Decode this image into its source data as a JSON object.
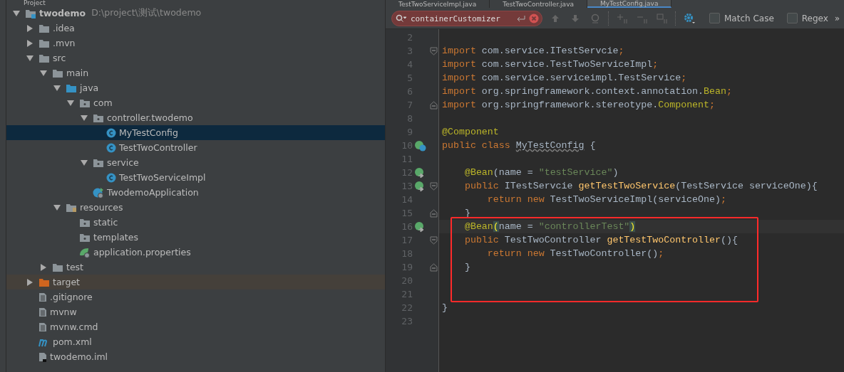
{
  "project_panel": {
    "title": "Project",
    "tree": [
      {
        "label": "twodemo",
        "path": "D:\\project\\测试\\twodemo",
        "kind": "module",
        "expanded": true,
        "selected": false,
        "children": [
          {
            "label": ".idea",
            "kind": "folder",
            "expanded": false,
            "selected": false
          },
          {
            "label": ".mvn",
            "kind": "folder",
            "expanded": false,
            "selected": false
          },
          {
            "label": "src",
            "kind": "folder",
            "expanded": true,
            "selected": false,
            "children": [
              {
                "label": "main",
                "kind": "folder",
                "expanded": true,
                "selected": false,
                "children": [
                  {
                    "label": "java",
                    "kind": "source",
                    "expanded": true,
                    "selected": false,
                    "children": [
                      {
                        "label": "com",
                        "kind": "package",
                        "expanded": true,
                        "selected": false,
                        "children": [
                          {
                            "label": "controller.twodemo",
                            "kind": "package",
                            "expanded": true,
                            "selected": false,
                            "children": [
                              {
                                "label": "MyTestConfig",
                                "kind": "class",
                                "selected": true
                              },
                              {
                                "label": "TestTwoController",
                                "kind": "class",
                                "selected": false
                              }
                            ]
                          },
                          {
                            "label": "service",
                            "kind": "package",
                            "expanded": true,
                            "selected": false,
                            "children": [
                              {
                                "label": "TestTwoServiceImpl",
                                "kind": "class",
                                "selected": false
                              }
                            ]
                          },
                          {
                            "label": "TwodemoApplication",
                            "kind": "app",
                            "selected": false
                          }
                        ]
                      }
                    ]
                  },
                  {
                    "label": "resources",
                    "kind": "resources",
                    "expanded": true,
                    "selected": false,
                    "children": [
                      {
                        "label": "static",
                        "kind": "package",
                        "selected": false
                      },
                      {
                        "label": "templates",
                        "kind": "package",
                        "selected": false
                      },
                      {
                        "label": "application.properties",
                        "kind": "properties",
                        "selected": false
                      }
                    ]
                  }
                ]
              },
              {
                "label": "test",
                "kind": "folder",
                "expanded": false,
                "selected": false
              }
            ]
          },
          {
            "label": "target",
            "kind": "excluded",
            "expanded": false,
            "selected": false
          },
          {
            "label": ".gitignore",
            "kind": "file",
            "selected": false
          },
          {
            "label": "mvnw",
            "kind": "file",
            "selected": false
          },
          {
            "label": "mvnw.cmd",
            "kind": "file",
            "selected": false
          },
          {
            "label": "pom.xml",
            "kind": "maven",
            "selected": false
          },
          {
            "label": "twodemo.iml",
            "kind": "iml",
            "selected": false
          }
        ]
      }
    ]
  },
  "editor": {
    "tabs": [
      {
        "label": "TestTwoServiceImpl.java",
        "selected": false
      },
      {
        "label": "TestTwoController.java",
        "selected": false
      },
      {
        "label": "MyTestConfig.java",
        "selected": true
      }
    ],
    "search": {
      "value": "containerCustomizer",
      "no_match": true,
      "options": [
        {
          "label": "Match Case",
          "checked": false
        },
        {
          "label": "Regex",
          "checked": false
        }
      ],
      "more": "»"
    },
    "lines": [
      {
        "number": "2"
      },
      {
        "number": "3",
        "fold_open": true,
        "segments": [
          {
            "kind": "kw",
            "text": "import "
          },
          {
            "kind": "plain",
            "text": "com.service.ITestServcie"
          },
          {
            "kind": "kw",
            "text": ";"
          }
        ]
      },
      {
        "number": "4",
        "segments": [
          {
            "kind": "kw",
            "text": "import "
          },
          {
            "kind": "plain",
            "text": "com.service.TestTwoServiceImpl"
          },
          {
            "kind": "kw",
            "text": ";"
          }
        ]
      },
      {
        "number": "5",
        "segments": [
          {
            "kind": "kw",
            "text": "import "
          },
          {
            "kind": "plain",
            "text": "com.service.serviceimpl.TestService"
          },
          {
            "kind": "kw",
            "text": ";"
          }
        ]
      },
      {
        "number": "6",
        "segments": [
          {
            "kind": "kw",
            "text": "import "
          },
          {
            "kind": "plain",
            "text": "org.springframework.context.annotation."
          },
          {
            "kind": "ann",
            "text": "Bean"
          },
          {
            "kind": "kw",
            "text": ";"
          }
        ]
      },
      {
        "number": "7",
        "fold_close": true,
        "segments": [
          {
            "kind": "kw",
            "text": "import "
          },
          {
            "kind": "plain",
            "text": "org.springframework.stereotype."
          },
          {
            "kind": "ann",
            "text": "Component"
          },
          {
            "kind": "kw",
            "text": ";"
          }
        ]
      },
      {
        "number": "8"
      },
      {
        "number": "9",
        "segments": [
          {
            "kind": "ann",
            "text": "@Component"
          }
        ]
      },
      {
        "number": "10",
        "class_marker": true,
        "segments": [
          {
            "kind": "kw",
            "text": "public class "
          },
          {
            "kind": "warn",
            "text": "MyTestConfig"
          },
          {
            "kind": "plain",
            "text": " {"
          }
        ]
      },
      {
        "number": "11"
      },
      {
        "number": "12",
        "bean_marker": true,
        "segments": [
          {
            "kind": "ann",
            "text": "    @Bean"
          },
          {
            "kind": "plain",
            "text": "(name = "
          },
          {
            "kind": "str",
            "text": "\"testService\""
          },
          {
            "kind": "plain",
            "text": ")"
          }
        ]
      },
      {
        "number": "13",
        "bean_marker": true,
        "fold_open": true,
        "segments": [
          {
            "kind": "kw",
            "text": "    public "
          },
          {
            "kind": "plain",
            "text": "ITestServcie "
          },
          {
            "kind": "method",
            "text": "getTestTwoService"
          },
          {
            "kind": "plain",
            "text": "(TestService serviceOne){"
          }
        ]
      },
      {
        "number": "14",
        "segments": [
          {
            "kind": "kw",
            "text": "        return new "
          },
          {
            "kind": "plain",
            "text": "TestTwoServiceImpl(serviceOne)"
          },
          {
            "kind": "kw",
            "text": ";"
          }
        ]
      },
      {
        "number": "15",
        "fold_close": true,
        "segments": [
          {
            "kind": "plain",
            "text": "    }"
          }
        ]
      }
    ],
    "boxed_lines": [
      {
        "number": "16",
        "bean_marker": true,
        "current": true,
        "segments": [
          {
            "kind": "ann",
            "text": "    @Bean"
          },
          {
            "kind": "bracket",
            "text": "("
          },
          {
            "kind": "plain",
            "text": "name = "
          },
          {
            "kind": "str",
            "text": "\"controllerTest\""
          },
          {
            "kind": "bracket",
            "text": ")"
          }
        ]
      },
      {
        "number": "17",
        "fold_open": true,
        "segments": [
          {
            "kind": "kw",
            "text": "    public "
          },
          {
            "kind": "plain",
            "text": "TestTwoController "
          },
          {
            "kind": "method",
            "text": "getTestTwoController"
          },
          {
            "kind": "plain",
            "text": "(){"
          }
        ]
      },
      {
        "number": "18",
        "segments": [
          {
            "kind": "kw",
            "text": "        return new "
          },
          {
            "kind": "plain",
            "text": "TestTwoController()"
          },
          {
            "kind": "kw",
            "text": ";"
          }
        ]
      },
      {
        "number": "19",
        "fold_close": true,
        "segments": [
          {
            "kind": "plain",
            "text": "    }"
          }
        ]
      },
      {
        "number": "20"
      },
      {
        "number": "21"
      }
    ],
    "lines_after": [
      {
        "number": "22",
        "segments": [
          {
            "kind": "plain",
            "text": "}"
          }
        ]
      },
      {
        "number": "23"
      }
    ]
  }
}
